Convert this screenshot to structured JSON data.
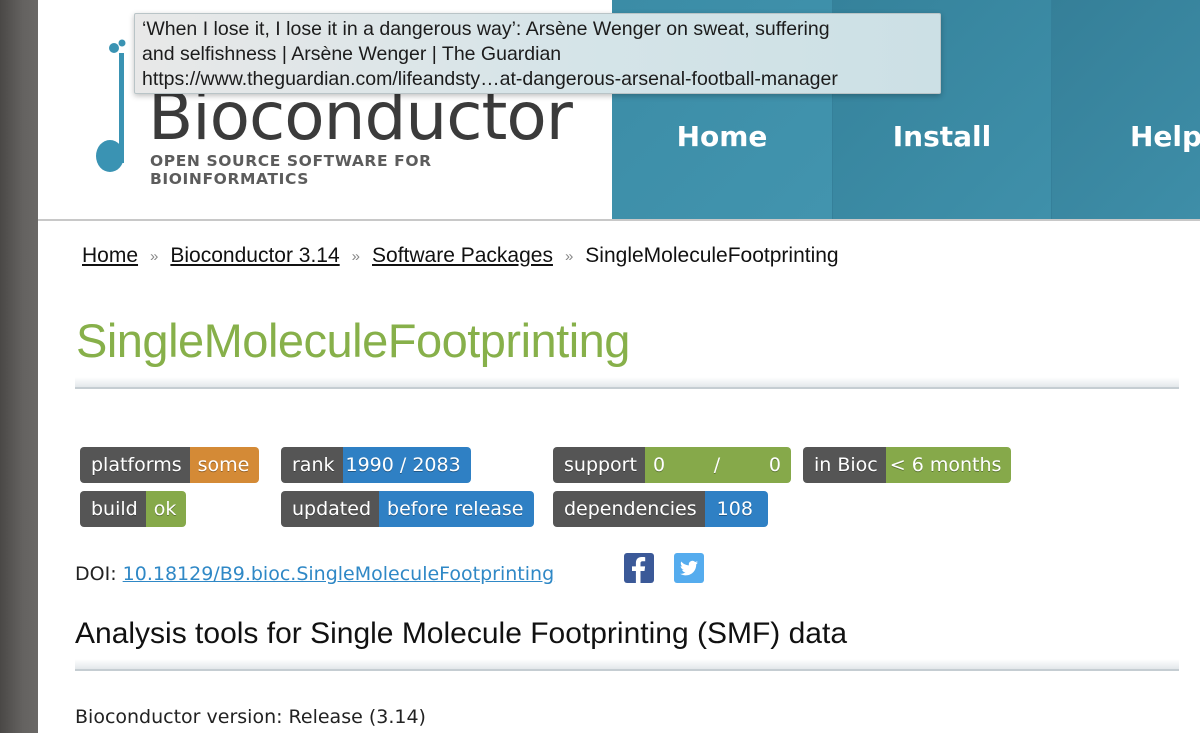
{
  "tooltip": {
    "line1": "‘When I lose it, I lose it in a dangerous way’: Arsène Wenger on sweat, suffering",
    "line2": "and selfishness | Arsène Wenger | The Guardian",
    "line3": "https://www.theguardian.com/lifeandsty…at-dangerous-arsenal-football-manager"
  },
  "header": {
    "logo_word": "Bioconductor",
    "logo_tagline": "OPEN SOURCE SOFTWARE FOR BIOINFORMATICS",
    "logo_icon": "music-note-icon",
    "nav": [
      {
        "label": "Home"
      },
      {
        "label": "Install"
      },
      {
        "label": "Help"
      }
    ],
    "nav_color": "#3a8aa3"
  },
  "breadcrumb": {
    "items": [
      {
        "label": "Home"
      },
      {
        "label": "Bioconductor 3.14"
      },
      {
        "label": "Software Packages"
      },
      {
        "label": "SingleMoleculeFootprinting"
      }
    ],
    "separator": "»"
  },
  "package": {
    "title": "SingleMoleculeFootprinting",
    "title_color": "#87b04a",
    "badges": [
      {
        "key": "platforms",
        "value": "some",
        "color": "#d48a36"
      },
      {
        "key": "rank",
        "value": "1990 / 2083",
        "color": "#2f80c4"
      },
      {
        "key": "support",
        "value_left": "0",
        "value_sep": "/",
        "value_right": "0",
        "color": "#86a94a"
      },
      {
        "key": "in Bioc",
        "value": "< 6 months",
        "color": "#86a94a"
      },
      {
        "key": "build",
        "value": "ok",
        "color": "#86a94a"
      },
      {
        "key": "updated",
        "value": "before release",
        "color": "#2f80c4"
      },
      {
        "key": "dependencies",
        "value": "108",
        "color": "#2f80c4"
      }
    ],
    "doi_label": "DOI:",
    "doi_link": "10.18129/B9.bioc.SingleMoleculeFootprinting",
    "social": [
      {
        "name": "facebook",
        "icon": "facebook-icon",
        "color": "#3b5998"
      },
      {
        "name": "twitter",
        "icon": "twitter-icon",
        "color": "#55acee"
      }
    ],
    "subtitle": "Analysis tools for Single Molecule Footprinting (SMF) data",
    "version_text": "Bioconductor version: Release (3.14)"
  }
}
